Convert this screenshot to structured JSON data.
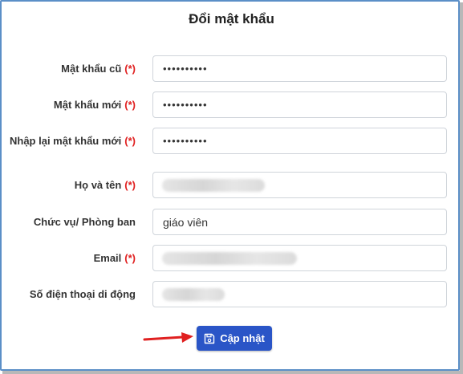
{
  "form": {
    "title": "Đổi mật khẩu",
    "required_marker": "(*)",
    "fields": {
      "old_password": {
        "label": "Mật khẩu cũ",
        "value": "••••••••••"
      },
      "new_password": {
        "label": "Mật khẩu mới",
        "value": "••••••••••"
      },
      "confirm_password": {
        "label": "Nhập lại mật khẩu mới",
        "value": "••••••••••"
      },
      "full_name": {
        "label": "Họ và tên",
        "value": ""
      },
      "position": {
        "label": "Chức vụ/ Phòng ban",
        "value": "giáo viên"
      },
      "email": {
        "label": "Email",
        "value": ""
      },
      "phone": {
        "label": "Số điện thoại di động",
        "value": ""
      }
    },
    "submit_label": "Cập nhật",
    "submit_icon": "save-icon"
  },
  "colors": {
    "primary": "#2a55c7",
    "required": "#e02020",
    "frame_border": "#5b8fc7",
    "arrow": "#e02020"
  }
}
